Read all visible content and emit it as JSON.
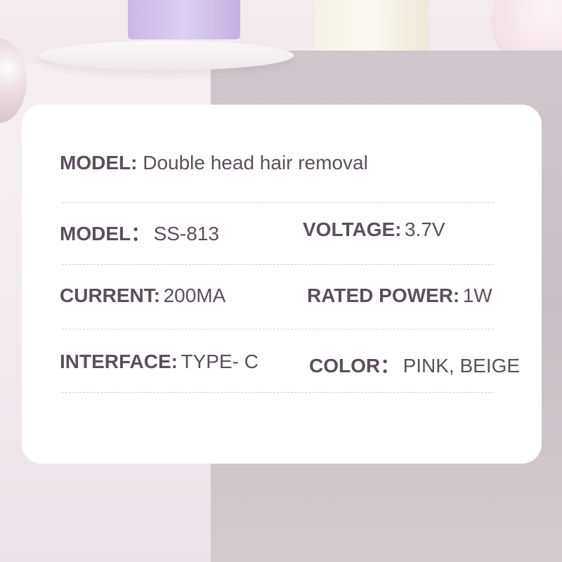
{
  "heading": {
    "key": "MODEL:",
    "value": "Double head hair removal"
  },
  "specs": [
    {
      "key": "MODEL：",
      "value": "SS-813"
    },
    {
      "key": "VOLTAGE:",
      "value": "3.7V"
    },
    {
      "key": "CURRENT:",
      "value": "200MA"
    },
    {
      "key": "RATED POWER:",
      "value": "1W"
    },
    {
      "key": "INTERFACE:",
      "value": "TYPE- C"
    },
    {
      "key": "COLOR：",
      "value": "PINK, BEIGE"
    }
  ],
  "colors": {
    "text": "#5b4f5c",
    "card": "#ffffff",
    "divider": "#d3cdd2"
  }
}
